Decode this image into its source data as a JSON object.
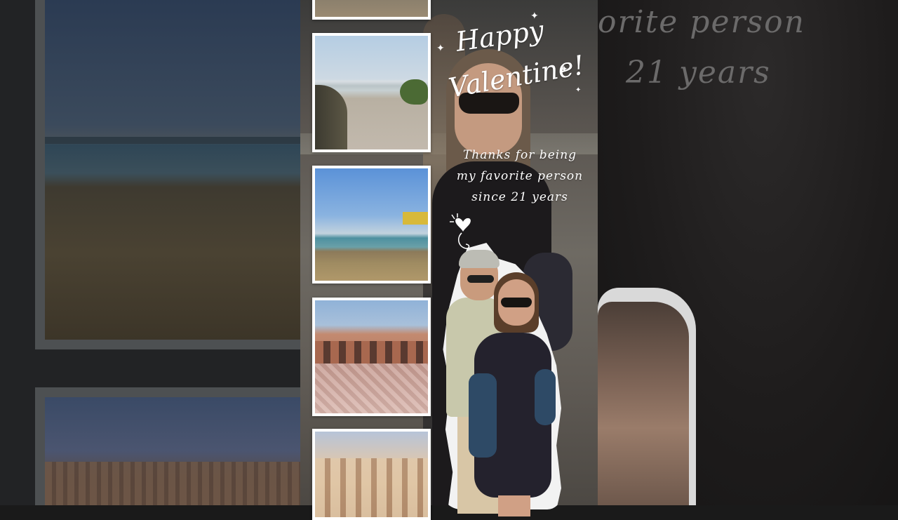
{
  "card": {
    "title_line1": "Happy",
    "title_line2": "Valentine!",
    "subtitle": [
      "Thanks for being",
      "my favorite person",
      "since 21 years"
    ]
  },
  "background_right": {
    "script_line1": "orite person",
    "script_line2": "21 years"
  },
  "photo_strip": [
    {
      "subject": "beach-top-crop"
    },
    {
      "subject": "beach-path-to-sea"
    },
    {
      "subject": "sea-shore-with-yellow-building"
    },
    {
      "subject": "courtyard-with-arches"
    },
    {
      "subject": "building-with-balustrade"
    }
  ],
  "icons": {
    "sparkle": "✦",
    "heart": "♥"
  },
  "colors": {
    "text": "#ffffff",
    "thumb_border": "#ffffff",
    "side_background": "#222325"
  }
}
